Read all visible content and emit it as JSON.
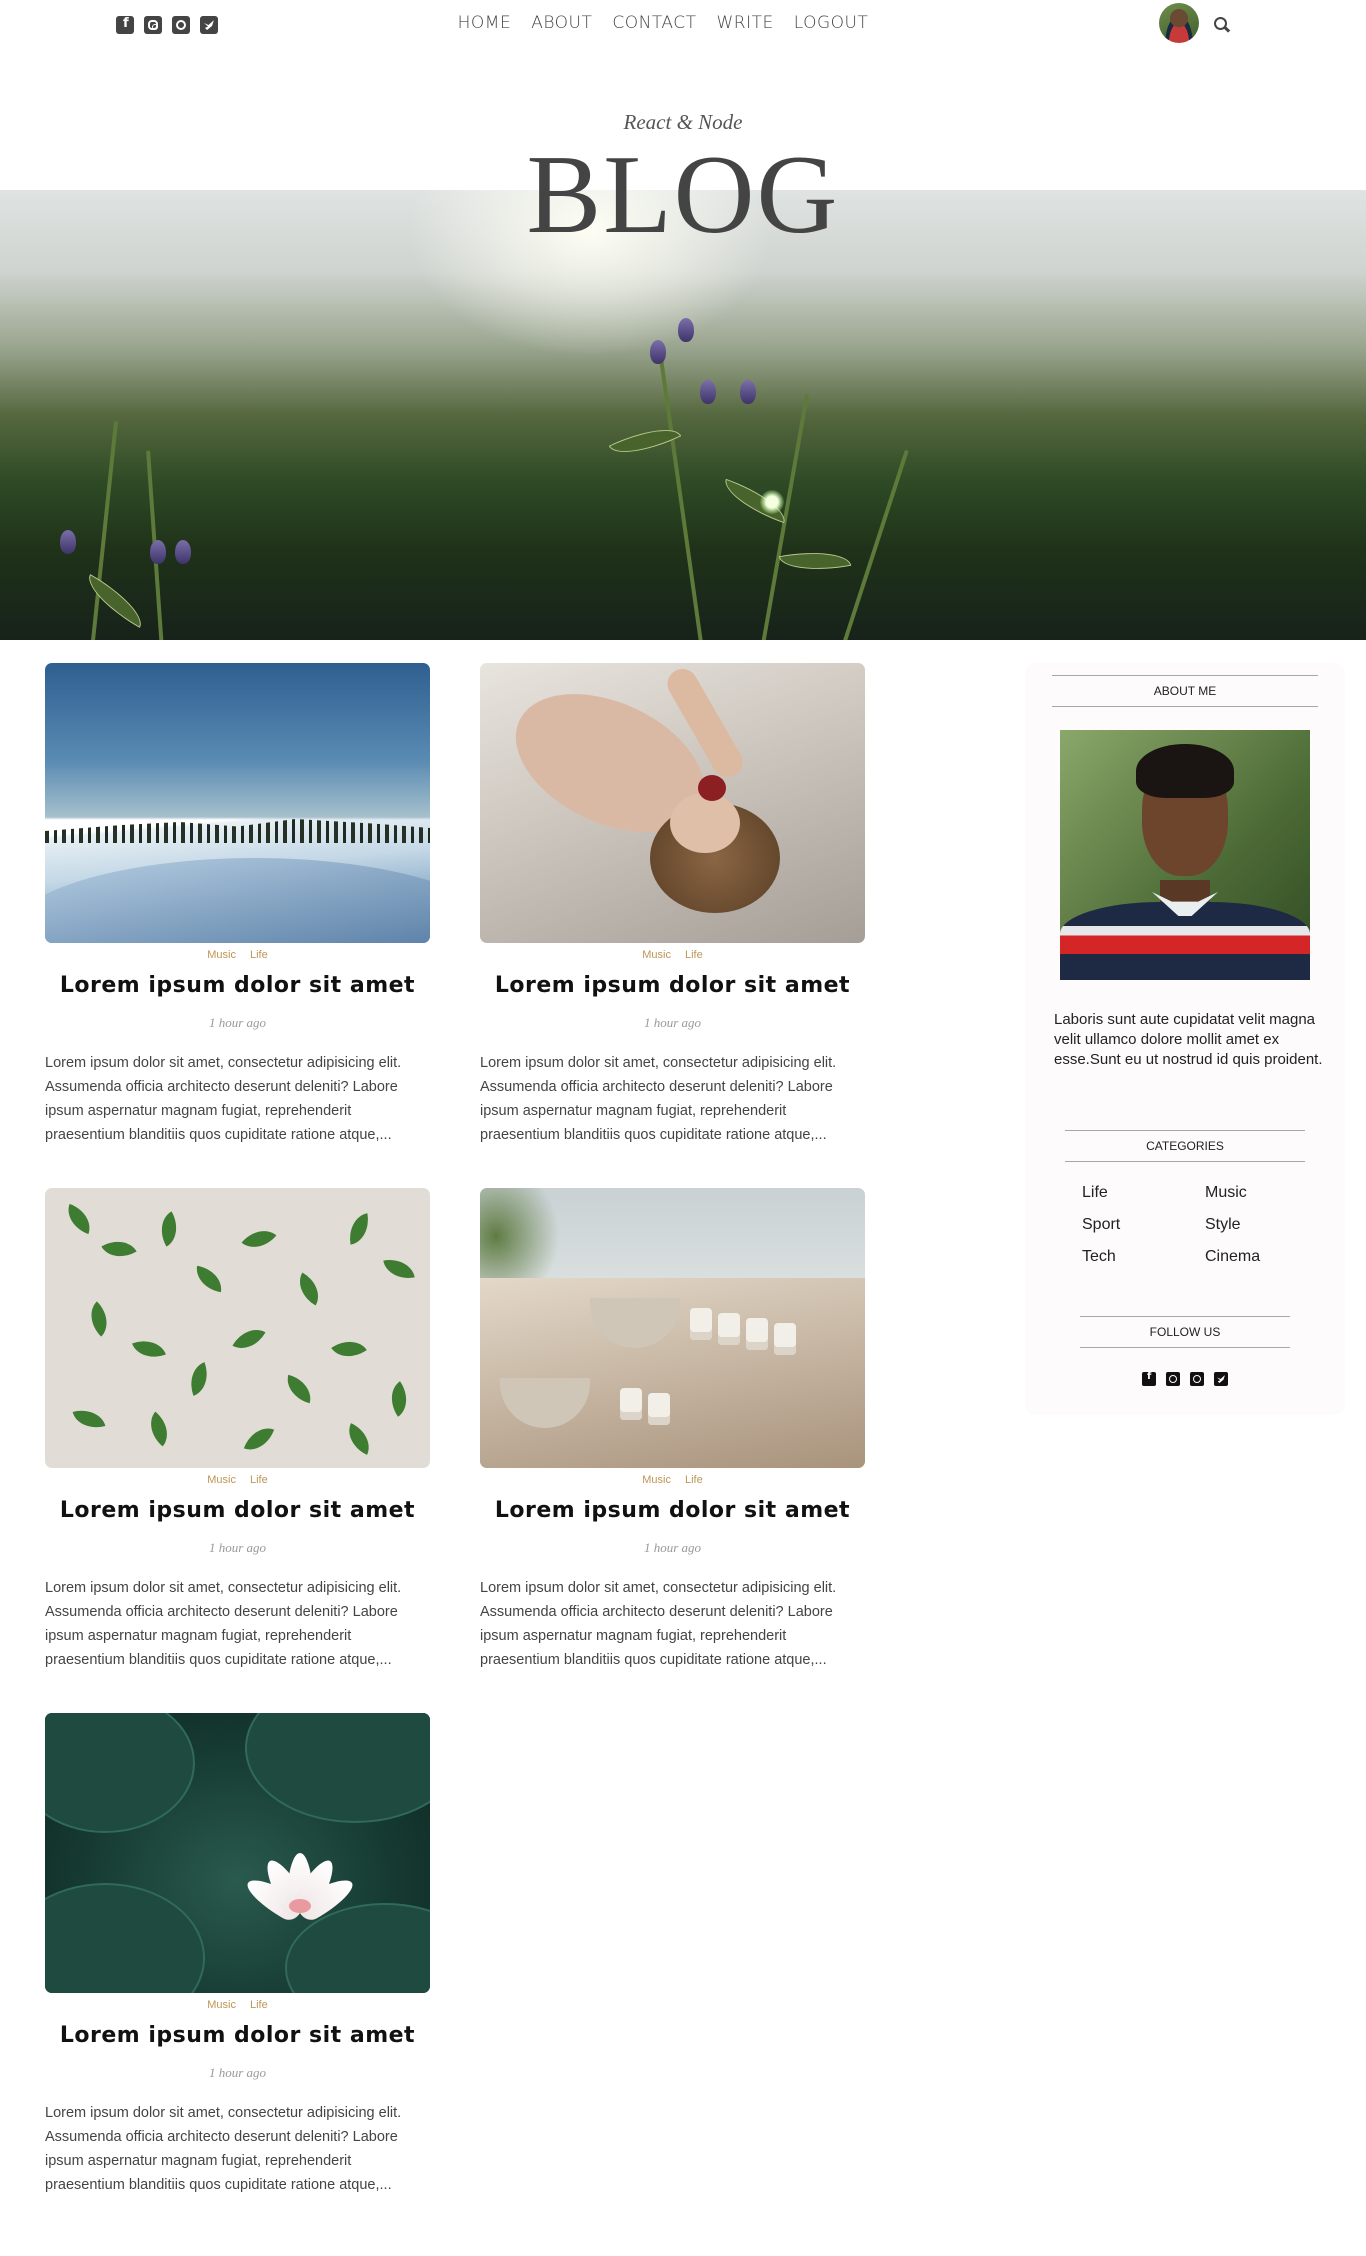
{
  "topbar": {
    "social_icons": [
      "facebook-square-icon",
      "instagram-square-icon",
      "pinterest-square-icon",
      "twitter-square-icon"
    ],
    "menu": [
      {
        "label": "HOME"
      },
      {
        "label": "ABOUT"
      },
      {
        "label": "CONTACT"
      },
      {
        "label": "WRITE"
      },
      {
        "label": "LOGOUT"
      }
    ],
    "right_icons": [
      "user-avatar",
      "search-icon"
    ]
  },
  "hero": {
    "subtitle": "React & Node",
    "title": "BLOG"
  },
  "posts": [
    {
      "categories": [
        "Music",
        "Life"
      ],
      "title": "Lorem ipsum dolor sit amet",
      "time": "1 hour ago",
      "excerpt": "Lorem ipsum dolor sit amet, consectetur adipisicing elit. Assumenda officia architecto deserunt deleniti? Labore ipsum aspernatur magnam fugiat, reprehenderit praesentium blanditiis quos cupiditate ratione atque,..."
    },
    {
      "categories": [
        "Music",
        "Life"
      ],
      "title": "Lorem ipsum dolor sit amet",
      "time": "1 hour ago",
      "excerpt": "Lorem ipsum dolor sit amet, consectetur adipisicing elit. Assumenda officia architecto deserunt deleniti? Labore ipsum aspernatur magnam fugiat, reprehenderit praesentium blanditiis quos cupiditate ratione atque,..."
    },
    {
      "categories": [
        "Music",
        "Life"
      ],
      "title": "Lorem ipsum dolor sit amet",
      "time": "1 hour ago",
      "excerpt": "Lorem ipsum dolor sit amet, consectetur adipisicing elit. Assumenda officia architecto deserunt deleniti? Labore ipsum aspernatur magnam fugiat, reprehenderit praesentium blanditiis quos cupiditate ratione atque,..."
    },
    {
      "categories": [
        "Music",
        "Life"
      ],
      "title": "Lorem ipsum dolor sit amet",
      "time": "1 hour ago",
      "excerpt": "Lorem ipsum dolor sit amet, consectetur adipisicing elit. Assumenda officia architecto deserunt deleniti? Labore ipsum aspernatur magnam fugiat, reprehenderit praesentium blanditiis quos cupiditate ratione atque,..."
    },
    {
      "categories": [
        "Music",
        "Life"
      ],
      "title": "Lorem ipsum dolor sit amet",
      "time": "1 hour ago",
      "excerpt": "Lorem ipsum dolor sit amet, consectetur adipisicing elit. Assumenda officia architecto deserunt deleniti? Labore ipsum aspernatur magnam fugiat, reprehenderit praesentium blanditiis quos cupiditate ratione atque,..."
    }
  ],
  "sidebar": {
    "about_heading": "ABOUT ME",
    "about_text": "Laboris sunt aute cupidatat velit magna velit ullamco dolore mollit amet ex esse.Sunt eu ut nostrud id quis proident.",
    "categories_heading": "CATEGORIES",
    "categories": [
      "Life",
      "Music",
      "Sport",
      "Style",
      "Tech",
      "Cinema"
    ],
    "follow_heading": "FOLLOW US",
    "follow_icons": [
      "facebook-square-icon",
      "instagram-square-icon",
      "pinterest-square-icon",
      "twitter-square-icon"
    ]
  }
}
